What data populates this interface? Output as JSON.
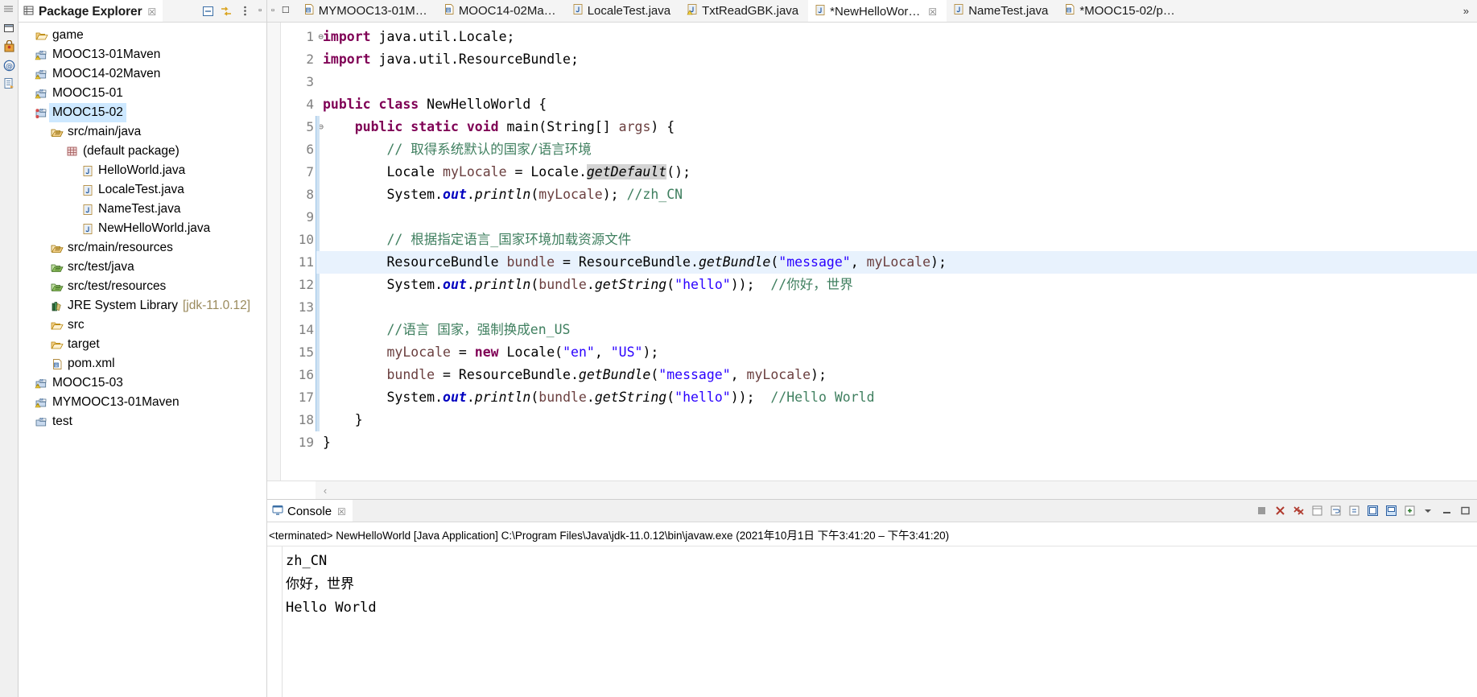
{
  "iconbar": {
    "icons": [
      "overview-icon",
      "restore-perspective-icon",
      "security-icon",
      "annotation-icon",
      "outline-icon"
    ]
  },
  "explorer": {
    "tab_label": "Package Explorer",
    "tab_close": "☒",
    "toolbar": [
      "collapse-all-icon",
      "link-with-editor-icon",
      "view-menu-icon"
    ],
    "window_buttons": [
      "minimize-icon",
      "maximize-icon"
    ],
    "tree": [
      {
        "label": "game",
        "depth": 0,
        "arrow": "›",
        "icon": "folder-icon",
        "selected": false
      },
      {
        "label": "MOOC13-01Maven",
        "depth": 0,
        "arrow": "›",
        "icon": "maven-warn-project-icon",
        "selected": false
      },
      {
        "label": "MOOC14-02Maven",
        "depth": 0,
        "arrow": "›",
        "icon": "maven-warn-project-icon",
        "selected": false
      },
      {
        "label": "MOOC15-01",
        "depth": 0,
        "arrow": "›",
        "icon": "maven-warn-project-icon",
        "selected": false
      },
      {
        "label": "MOOC15-02",
        "depth": 0,
        "arrow": "⌄",
        "icon": "maven-error-project-icon",
        "selected": true
      },
      {
        "label": "src/main/java",
        "depth": 1,
        "arrow": "⌄",
        "icon": "source-folder-icon",
        "selected": false
      },
      {
        "label": "(default package)",
        "depth": 2,
        "arrow": "⌄",
        "icon": "package-icon",
        "selected": false
      },
      {
        "label": "HelloWorld.java",
        "depth": 3,
        "arrow": "›",
        "icon": "java-file-icon",
        "selected": false
      },
      {
        "label": "LocaleTest.java",
        "depth": 3,
        "arrow": "›",
        "icon": "java-file-icon",
        "selected": false
      },
      {
        "label": "NameTest.java",
        "depth": 3,
        "arrow": "›",
        "icon": "java-file-icon",
        "selected": false
      },
      {
        "label": "NewHelloWorld.java",
        "depth": 3,
        "arrow": "›",
        "icon": "java-file-icon",
        "selected": false
      },
      {
        "label": "src/main/resources",
        "depth": 1,
        "arrow": "›",
        "icon": "source-folder-icon",
        "selected": false
      },
      {
        "label": "src/test/java",
        "depth": 1,
        "arrow": "",
        "icon": "source-folder-green-icon",
        "selected": false
      },
      {
        "label": "src/test/resources",
        "depth": 1,
        "arrow": "",
        "icon": "source-folder-green-icon",
        "selected": false
      },
      {
        "label": "JRE System Library",
        "suffix": "[jdk-11.0.12]",
        "depth": 1,
        "arrow": "›",
        "icon": "jre-library-icon",
        "selected": false
      },
      {
        "label": "src",
        "depth": 1,
        "arrow": "›",
        "icon": "folder-icon",
        "selected": false
      },
      {
        "label": "target",
        "depth": 1,
        "arrow": "",
        "icon": "folder-icon",
        "selected": false
      },
      {
        "label": "pom.xml",
        "depth": 1,
        "arrow": "",
        "icon": "xml-file-icon",
        "selected": false
      },
      {
        "label": "MOOC15-03",
        "depth": 0,
        "arrow": "›",
        "icon": "maven-warn-project-icon",
        "selected": false
      },
      {
        "label": "MYMOOC13-01Maven",
        "depth": 0,
        "arrow": "›",
        "icon": "maven-warn-project-icon",
        "selected": false
      },
      {
        "label": "test",
        "depth": 0,
        "arrow": "›",
        "icon": "maven-project-icon",
        "selected": false
      }
    ]
  },
  "editor": {
    "left_buttons": [
      "minimize-icon",
      "maximize-icon"
    ],
    "overflow_label": "»",
    "tabs": [
      {
        "label": "MYMOOC13-01M…",
        "icon": "xml-file-icon",
        "active": false,
        "closable": false
      },
      {
        "label": "MOOC14-02Ma…",
        "icon": "xml-file-icon",
        "active": false,
        "closable": false
      },
      {
        "label": "LocaleTest.java",
        "icon": "java-file-icon",
        "active": false,
        "closable": false
      },
      {
        "label": "TxtReadGBK.java",
        "icon": "java-warn-file-icon",
        "active": false,
        "closable": false
      },
      {
        "label": "*NewHelloWor…",
        "icon": "java-file-icon",
        "active": true,
        "closable": true
      },
      {
        "label": "NameTest.java",
        "icon": "java-file-icon",
        "active": false,
        "closable": false
      },
      {
        "label": "*MOOC15-02/p…",
        "icon": "xml-file-icon",
        "active": false,
        "closable": false
      }
    ],
    "line_numbers": [
      "1",
      "2",
      "3",
      "4",
      "5",
      "6",
      "7",
      "8",
      "9",
      "10",
      "11",
      "12",
      "13",
      "14",
      "15",
      "16",
      "17",
      "18",
      "19"
    ],
    "folds": {
      "1": "⊖",
      "5": "⊖"
    },
    "highlighted_line": 11,
    "code_lines": [
      "import java.util.Locale;",
      "import java.util.ResourceBundle;",
      "",
      "public class NewHelloWorld {",
      "    public static void main(String[] args) {",
      "        // 取得系统默认的国家/语言环境",
      "        Locale myLocale = Locale.getDefault();",
      "        System.out.println(myLocale); //zh_CN",
      "",
      "        // 根据指定语言_国家环境加载资源文件",
      "        ResourceBundle bundle = ResourceBundle.getBundle(\"message\", myLocale);",
      "        System.out.println(bundle.getString(\"hello\"));  //你好，世界",
      "",
      "        //语言 国家，强制换成en_US",
      "        myLocale = new Locale(\"en\", \"US\");",
      "        bundle = ResourceBundle.getBundle(\"message\", myLocale);",
      "        System.out.println(bundle.getString(\"hello\"));  //Hello World",
      "    }",
      "}"
    ],
    "scroll_left_arrow": "‹"
  },
  "console": {
    "tab_label": "Console",
    "tab_close": "☒",
    "toolbar_icons": [
      "terminate-icon",
      "remove-launch-icon",
      "remove-all-icon",
      "open-console-icon",
      "word-wrap-icon",
      "scroll-lock-icon",
      "pin-console-icon",
      "display-console-icon",
      "new-console-icon",
      "view-menu-icon",
      "minimize-icon",
      "maximize-icon"
    ],
    "status_line": "<terminated> NewHelloWorld [Java Application] C:\\Program Files\\Java\\jdk-11.0.12\\bin\\javaw.exe  (2021年10月1日 下午3:41:20 – 下午3:41:20)",
    "output_lines": [
      "zh_CN",
      "你好，世界",
      "Hello World"
    ]
  },
  "colors": {
    "selection": "#cde8ff",
    "line_highlight": "#e8f2fd",
    "keyword": "#7f0055",
    "string": "#2a00ff",
    "comment": "#3f7f5f",
    "field": "#0000c0",
    "local_var": "#6a3e3e"
  }
}
